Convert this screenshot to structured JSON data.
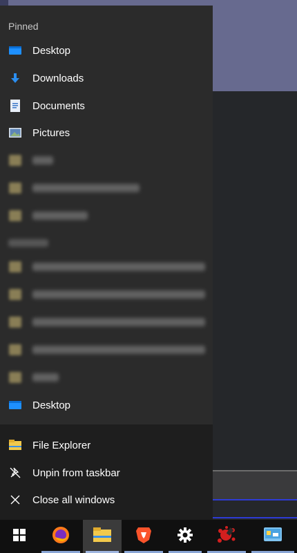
{
  "jumplist": {
    "pinned_label": "Pinned",
    "pinned": [
      {
        "label": "Desktop",
        "icon": "desktop-folder-icon"
      },
      {
        "label": "Downloads",
        "icon": "downloads-arrow-icon"
      },
      {
        "label": "Documents",
        "icon": "documents-icon"
      },
      {
        "label": "Pictures",
        "icon": "pictures-icon"
      }
    ],
    "frequent_last": {
      "label": "Desktop",
      "icon": "desktop-folder-icon"
    },
    "footer": [
      {
        "label": "File Explorer",
        "icon": "file-explorer-icon"
      },
      {
        "label": "Unpin from taskbar",
        "icon": "unpin-icon"
      },
      {
        "label": "Close all windows",
        "icon": "close-icon"
      }
    ]
  },
  "taskbar": {
    "items": [
      {
        "name": "start-button",
        "icon": "windows-logo-icon"
      },
      {
        "name": "firefox",
        "icon": "firefox-icon"
      },
      {
        "name": "file-explorer",
        "icon": "file-explorer-icon",
        "active": true
      },
      {
        "name": "brave",
        "icon": "brave-icon"
      },
      {
        "name": "settings",
        "icon": "gear-icon"
      },
      {
        "name": "app-red",
        "icon": "red-splatter-icon"
      },
      {
        "name": "app-blue",
        "icon": "control-panel-icon"
      }
    ]
  },
  "colors": {
    "jumplist_bg": "#2b2b2b",
    "footer_bg": "#1e1e1e",
    "taskbar_bg": "#101010",
    "accent_blue": "#1e90ff"
  }
}
